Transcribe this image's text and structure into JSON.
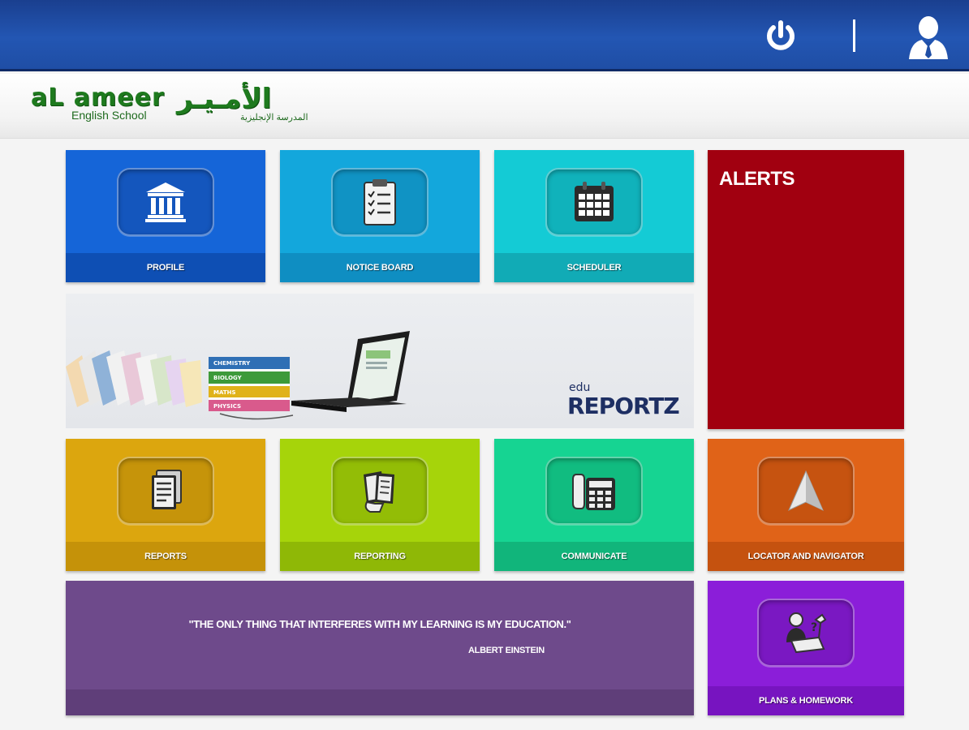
{
  "header": {
    "power_icon": "power-icon",
    "user_icon": "user-profile-icon",
    "bar_color": "#2356b3"
  },
  "logo": {
    "english": "aL ameer",
    "english_sub": "English School",
    "arabic": "الأمـيـر",
    "arabic_sub": "المدرسة الإنجليزية",
    "color": "#1e7a1e"
  },
  "tiles": {
    "profile": {
      "label": "PROFILE",
      "icon": "bank-building-icon",
      "color": "#1565d8"
    },
    "notice_board": {
      "label": "NOTICE BOARD",
      "icon": "clipboard-checklist-icon",
      "color": "#13a7dc"
    },
    "scheduler": {
      "label": "SCHEDULER",
      "icon": "calendar-icon",
      "color": "#14cbd5"
    },
    "alerts": {
      "title": "ALERTS",
      "color": "#a10010"
    },
    "reports": {
      "label": "REPORTS",
      "icon": "documents-icon",
      "color": "#dca60e"
    },
    "reporting": {
      "label": "REPORTING",
      "icon": "hand-holding-papers-icon",
      "color": "#a6d40a"
    },
    "communicate": {
      "label": "COMMUNICATE",
      "icon": "desk-phone-icon",
      "color": "#16d492"
    },
    "locator": {
      "label": "LOCATOR AND NAVIGATOR",
      "icon": "navigation-arrow-icon",
      "color": "#e06318"
    },
    "plans": {
      "label": "PLANS & HOMEWORK",
      "icon": "student-studying-icon",
      "color": "#8b1ed9"
    }
  },
  "banner": {
    "brand_small": "edu",
    "brand_main": "REPORTZ",
    "book_labels": [
      "CHEMISTRY",
      "BIOLOGY",
      "MATHS",
      "PHYSICS"
    ]
  },
  "quote": {
    "text": "\"THE ONLY THING THAT INTERFERES WITH MY LEARNING IS MY EDUCATION.\"",
    "author": "ALBERT EINSTEIN",
    "color": "#6e4a8b"
  }
}
